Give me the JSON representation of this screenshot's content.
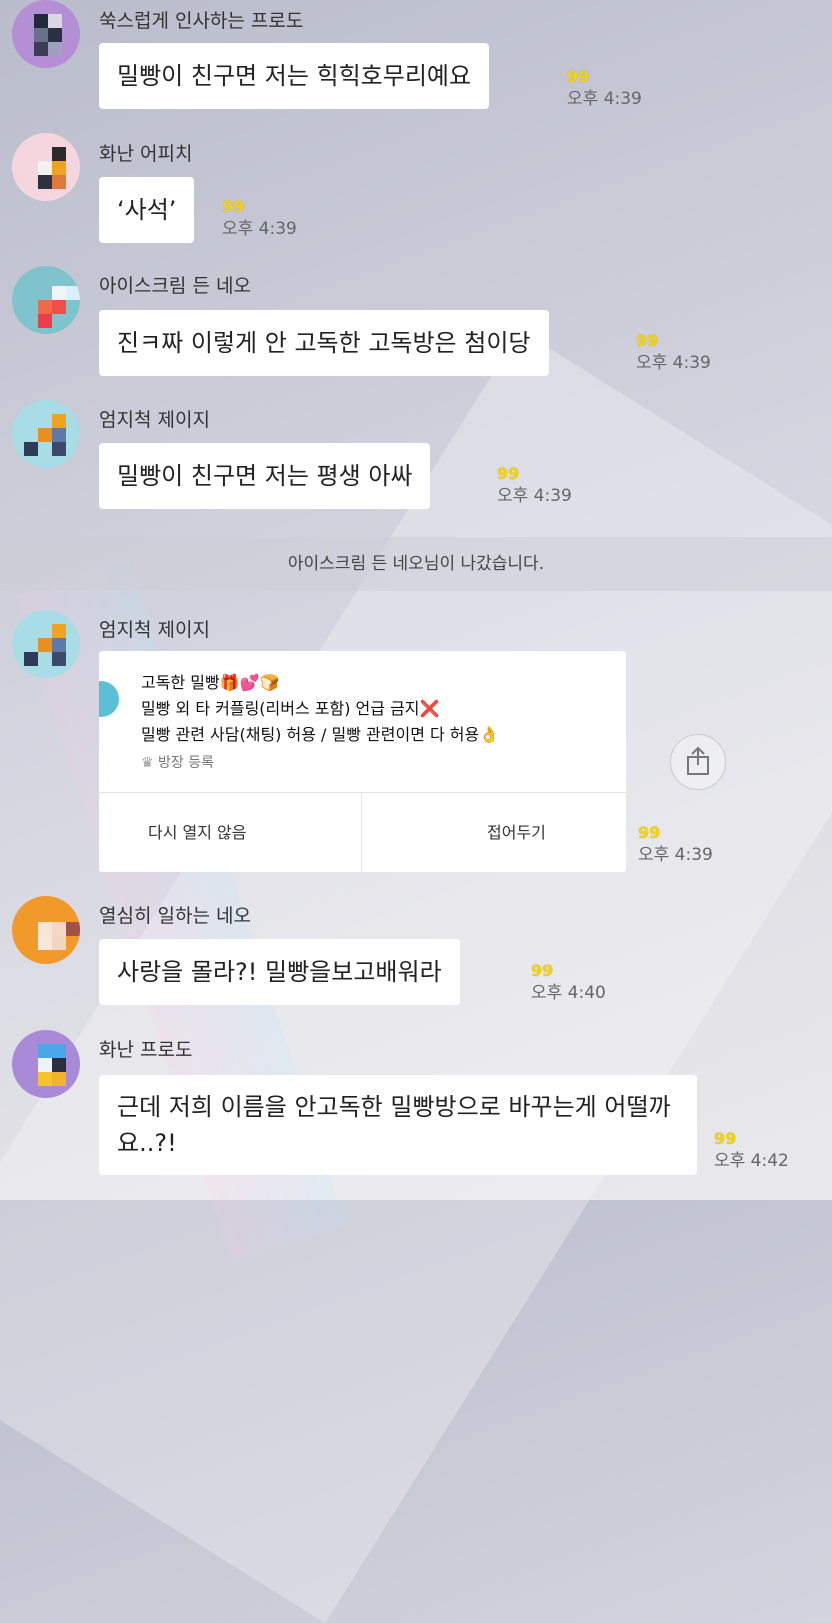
{
  "messages": [
    {
      "sender": "쑥스럽게 인사하는 프로도",
      "text": "밀빵이 친구면 저는 힉힉호무리예요",
      "count": "99",
      "time": "오후 4:39"
    },
    {
      "sender": "화난 어피치",
      "text": "‘사석’",
      "count": "99",
      "time": "오후 4:39"
    },
    {
      "sender": "아이스크림 든 네오",
      "text": "진ㅋ짜 이렇게 안 고독한 고독방은 첨이당",
      "count": "99",
      "time": "오후 4:39"
    },
    {
      "sender": "엄지척 제이지",
      "text": "밀빵이 친구면 저는 평생 아싸",
      "count": "99",
      "time": "오후 4:39"
    }
  ],
  "system_notice": "아이스크림 든 네오님이 나갔습니다.",
  "notice_message": {
    "sender": "엄지척 제이지",
    "title": "고독한 밀빵🎁💕🍞",
    "line1": "밀빵 외 타 커플링(리버스 포함) 언급 금지❌",
    "line2": "밀빵 관련 사담(채팅) 허용 / 밀빵 관련이면 다 허용👌",
    "registered": "방장 등록",
    "button_left": "다시 열지 않음",
    "button_right": "접어두기",
    "count": "99",
    "time": "오후 4:39"
  },
  "messages2": [
    {
      "sender": "열심히 일하는 네오",
      "text": "사랑을 몰라?! 밀빵을보고배워라",
      "count": "99",
      "time": "오후 4:40"
    },
    {
      "sender": "화난 프로도",
      "text": "근데 저희 이름을 안고독한 밀빵방으로 바꾸는게 어떨까요..?!",
      "count": "99",
      "time": "오후 4:42"
    }
  ],
  "icons": {
    "crown": "crown-icon",
    "share": "share-icon"
  }
}
